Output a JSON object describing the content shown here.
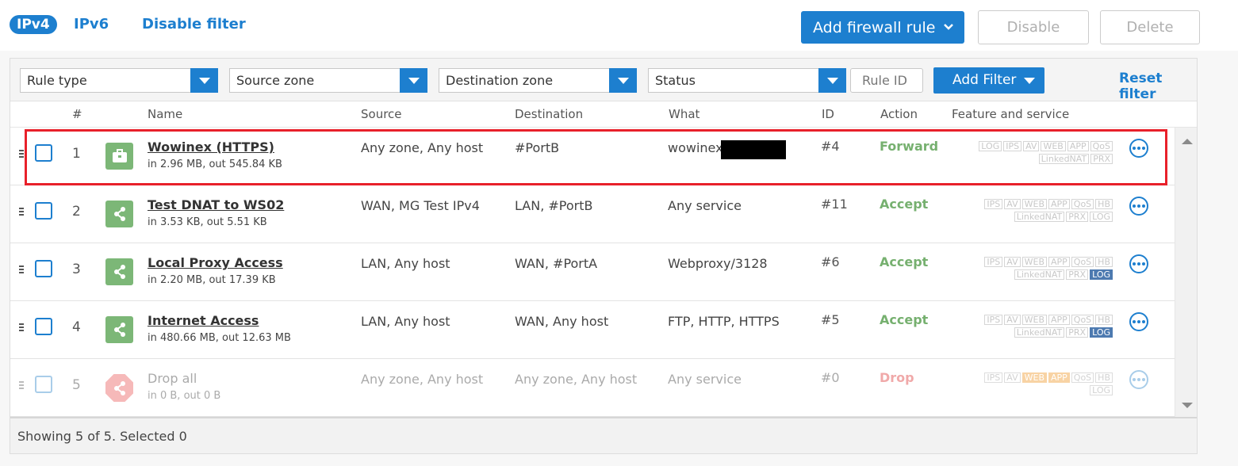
{
  "top": {
    "ipv4": "IPv4",
    "ipv6": "IPv6",
    "disable_filter": "Disable filter",
    "add_rule": "Add firewall rule",
    "disable": "Disable",
    "delete": "Delete"
  },
  "filters": {
    "rule_type": "Rule type",
    "source_zone": "Source zone",
    "destination_zone": "Destination zone",
    "status": "Status",
    "rule_id_placeholder": "Rule ID",
    "add_filter": "Add Filter",
    "reset_filter": "Reset filter"
  },
  "columns": {
    "num": "#",
    "name": "Name",
    "source": "Source",
    "destination": "Destination",
    "what": "What",
    "id": "ID",
    "action": "Action",
    "feature": "Feature and service"
  },
  "rules": [
    {
      "num": "1",
      "name": "Wowinex (HTTPS)",
      "stats": "in 2.96 MB, out 545.84 KB",
      "source": "Any zone, Any host",
      "destination": "#PortB",
      "what": "wowinex",
      "id": "#4",
      "action": "Forward",
      "badges_row1": [
        "LOG",
        "IPS",
        "AV",
        "WEB",
        "APP",
        "QoS"
      ],
      "badges_row2": [
        "LinkedNAT",
        "PRX"
      ]
    },
    {
      "num": "2",
      "name": "Test DNAT to WS02",
      "stats": "in 3.53 KB, out 5.51 KB",
      "source": "WAN, MG Test IPv4",
      "destination": "LAN, #PortB",
      "what": "Any service",
      "id": "#11",
      "action": "Accept",
      "badges_row1": [
        "IPS",
        "AV",
        "WEB",
        "APP",
        "QoS",
        "HB"
      ],
      "badges_row2": [
        "LinkedNAT",
        "PRX",
        "LOG"
      ]
    },
    {
      "num": "3",
      "name": "Local Proxy Access",
      "stats": "in 2.20 MB, out 17.39 KB",
      "source": "LAN, Any host",
      "destination": "WAN, #PortA",
      "what": "Webproxy/3128",
      "id": "#6",
      "action": "Accept",
      "badges_row1": [
        "IPS",
        "AV",
        "WEB",
        "APP",
        "QoS",
        "HB"
      ],
      "badges_row2": [
        "LinkedNAT",
        "PRX",
        "LOG"
      ]
    },
    {
      "num": "4",
      "name": "Internet Access",
      "stats": "in 480.66 MB, out 12.63 MB",
      "source": "LAN, Any host",
      "destination": "WAN, Any host",
      "what": "FTP, HTTP, HTTPS",
      "id": "#5",
      "action": "Accept",
      "badges_row1": [
        "IPS",
        "AV",
        "WEB",
        "APP",
        "QoS",
        "HB"
      ],
      "badges_row2": [
        "LinkedNAT",
        "PRX",
        "LOG"
      ]
    },
    {
      "num": "5",
      "name": "Drop all",
      "stats": "in 0 B, out 0 B",
      "source": "Any zone, Any host",
      "destination": "Any zone, Any host",
      "what": "Any service",
      "id": "#0",
      "action": "Drop",
      "badges_row1": [
        "IPS",
        "AV",
        "WEB",
        "APP",
        "QoS",
        "HB"
      ],
      "badges_row2": [
        "LOG"
      ]
    }
  ],
  "footer": "Showing 5 of 5. Selected 0",
  "colors": {
    "accent": "#1d7fcf",
    "accept": "#76b06f",
    "drop": "#f0a9a9",
    "highlight": "#e8202a",
    "log_active": "#4d7ab0"
  }
}
